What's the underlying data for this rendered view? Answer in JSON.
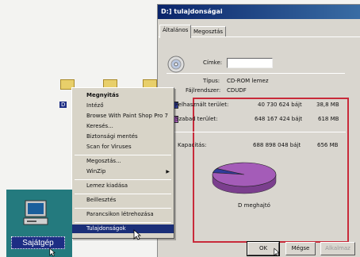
{
  "dialog": {
    "title": "D:] tulajdonságai",
    "tabs": [
      "Általános",
      "Megosztás"
    ],
    "fields": {
      "name_label": "Címke:",
      "name_value": "",
      "type_label": "Típus:",
      "type_value": "CD-ROM lemez",
      "fs_label": "Fájlrendszer:",
      "fs_value": "CDUDF"
    },
    "usage": {
      "used_label": "Felhasznált terület:",
      "used_bytes": "40 730 624 bájt",
      "used_size": "38,8 MB",
      "free_label": "Szabad terület:",
      "free_bytes": "648 167 424 bájt",
      "free_size": "618 MB",
      "capacity_label": "Kapacitás:",
      "capacity_bytes": "688 898 048 bájt",
      "capacity_size": "656 MB"
    },
    "drive_label": "D meghajtó",
    "buttons": {
      "ok": "OK",
      "cancel": "Mégse",
      "apply": "Alkalmaz"
    },
    "colors": {
      "used": "#2f3c9a",
      "free": "#a45cb8",
      "highlight": "#c82a3a"
    }
  },
  "chart_data": {
    "type": "pie",
    "categories": [
      "Felhasznált terület",
      "Szabad terület"
    ],
    "values": [
      40730624,
      648167424
    ],
    "title": "D meghajtó"
  },
  "context_menu": {
    "items": [
      {
        "label": "Megnyitás",
        "bold": true
      },
      {
        "label": "Intéző"
      },
      {
        "label": "Browse With Paint Shop Pro 7"
      },
      {
        "label": "Keresés..."
      },
      {
        "label": "Biztonsági mentés"
      },
      {
        "label": "Scan for Viruses"
      },
      {
        "sep": true
      },
      {
        "label": "Megosztás..."
      },
      {
        "label": "WinZip",
        "submenu": true
      },
      {
        "sep": true
      },
      {
        "label": "Lemez kiadása"
      },
      {
        "sep": true
      },
      {
        "label": "Beillesztés"
      },
      {
        "sep": true
      },
      {
        "label": "Parancsikon létrehozása"
      },
      {
        "sep": true
      },
      {
        "label": "Tulajdonságok",
        "selected": true
      }
    ]
  },
  "desktop": {
    "icon_label": "Sajátgép",
    "partial_label": "D"
  }
}
